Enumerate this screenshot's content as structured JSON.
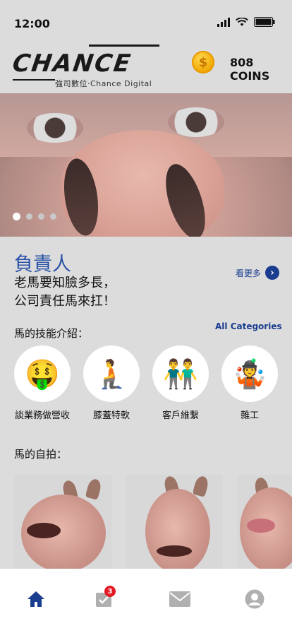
{
  "status": {
    "time": "12:00"
  },
  "header": {
    "logo_text": "CHANCE",
    "logo_subtitle": "強司數位·Chance Digital",
    "coins_label": "808 COINS",
    "coin_symbol": "$"
  },
  "banner": {
    "slide_count": 4,
    "active_slide": 1
  },
  "feature": {
    "title": "負責人",
    "description_line1": "老馬要知臉多長，",
    "description_line2": "公司責任馬來扛！",
    "see_more_label": "看更多",
    "see_more_icon": "chevron-right-icon"
  },
  "skills": {
    "section_title": "馬的技能介紹：",
    "all_categories_label": "All Categories",
    "items": [
      {
        "label": "談業務做營收",
        "icon": "money-mouth-face-icon",
        "glyph": "🤑"
      },
      {
        "label": "膝蓋特軟",
        "icon": "kneeling-person-icon",
        "glyph": "🧎"
      },
      {
        "label": "客戶維繫",
        "icon": "two-men-holding-hands-icon",
        "glyph": "👬"
      },
      {
        "label": "雜工",
        "icon": "person-juggling-icon",
        "glyph": "🤹"
      }
    ]
  },
  "selfies": {
    "section_title": "馬的自拍："
  },
  "tabbar": {
    "items": [
      {
        "icon": "home-icon",
        "active": true
      },
      {
        "icon": "task-check-icon",
        "badge": "3"
      },
      {
        "icon": "mail-icon"
      },
      {
        "icon": "profile-icon"
      }
    ]
  },
  "colors": {
    "accent": "#1a3d8f",
    "title_blue": "#2a52a8",
    "badge_red": "#e21c24"
  }
}
